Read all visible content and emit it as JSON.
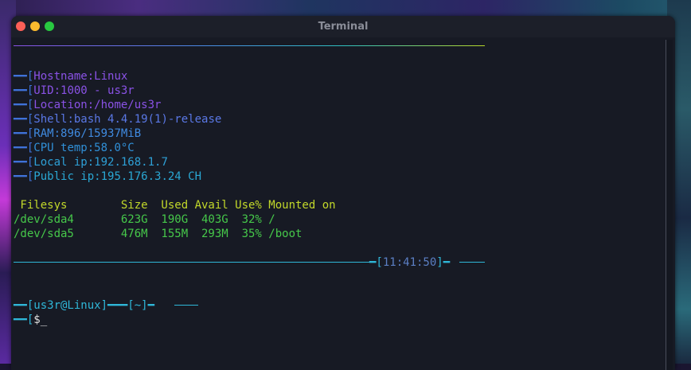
{
  "window": {
    "title": "Terminal"
  },
  "info_lines": [
    {
      "prefix": "━━[",
      "label": "Hostname:Linux"
    },
    {
      "prefix": "━━[",
      "label": "UID:1000 - us3r"
    },
    {
      "prefix": "━━[",
      "label": "Location:/home/us3r"
    },
    {
      "prefix": "━━[",
      "label": "Shell:bash 4.4.19(1)-release"
    },
    {
      "prefix": "━━[",
      "label": "RAM:896/15937MiB"
    },
    {
      "prefix": "━━[",
      "label": "CPU temp:58.0°C"
    },
    {
      "prefix": "━━[",
      "label": "Local ip:192.168.1.7"
    },
    {
      "prefix": "━━[",
      "label": "Public ip:195.176.3.24 CH"
    }
  ],
  "disk_table": {
    "header": " Filesys        Size  Used Avail Use% Mounted on",
    "rows": [
      "/dev/sda4       623G  190G  403G  32% /",
      "/dev/sda5       476M  155M  293M  35% /boot"
    ]
  },
  "clock": {
    "prefix": "━[",
    "time": "11:41:50",
    "suffix": "]━"
  },
  "prompt": {
    "line1_user": "━━[us3r@Linux]━",
    "line1_dir": "━━[~]━",
    "line2_prefix": "━━[",
    "line2_symbol": "$",
    "cursor": "_"
  },
  "colors": {
    "window_bg": "#171a24",
    "title_text": "#8a8d98",
    "close": "#fd5f57",
    "minimize": "#fdbb2e",
    "maximize": "#28c840",
    "info_blue": "#3f72d9",
    "info_purple": "#8a52e6",
    "table_header": "#c2d82a",
    "table_rows": "#46c84a",
    "clock": "#5b7fc4",
    "prompt": "#2fb7d8"
  }
}
